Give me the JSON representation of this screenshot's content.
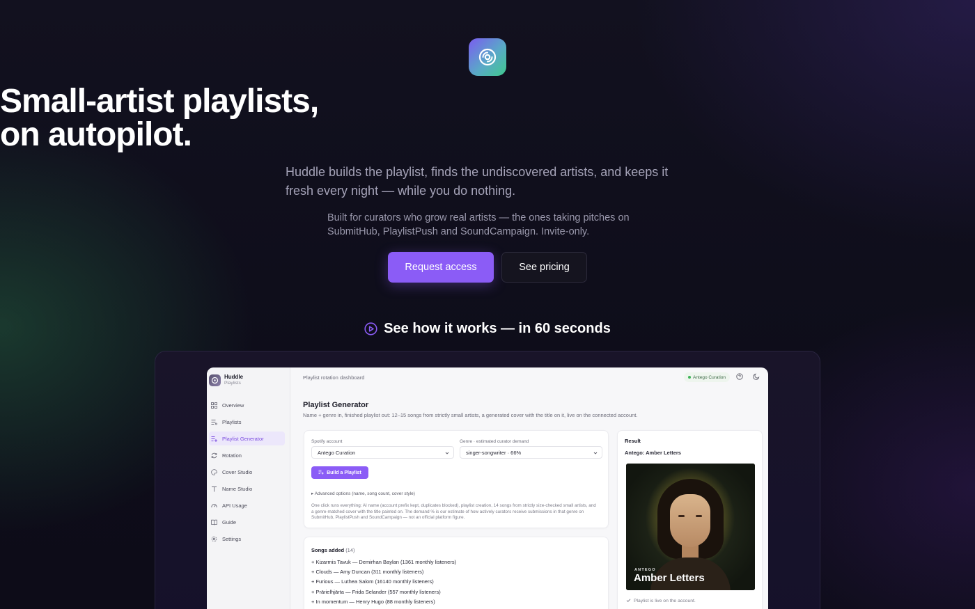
{
  "hero": {
    "headline_line1": "Small-artist playlists,",
    "headline_line2": "on autopilot.",
    "subhead": "Huddle builds the playlist, finds the undiscovered artists, and keeps it fresh every night — while you do nothing.",
    "subhead2": "Built for curators who grow real artists — the ones taking pitches on SubmitHub, PlaylistPush and SoundCampaign. Invite-only.",
    "primary_cta": "Request access",
    "secondary_cta": "See pricing",
    "how_it_works": "See how it works — in 60 seconds"
  },
  "colors": {
    "accent": "#8b5cf6",
    "background": "#0f0e1c",
    "logo_gradient": [
      "#7b5cf0",
      "#3fc98d"
    ]
  },
  "app": {
    "brand": {
      "name": "Huddle",
      "sub": "Playlists"
    },
    "sidebar": [
      {
        "label": "Overview",
        "icon": "grid-icon"
      },
      {
        "label": "Playlists",
        "icon": "list-icon"
      },
      {
        "label": "Playlist Generator",
        "icon": "list-plus-icon",
        "active": true
      },
      {
        "label": "Rotation",
        "icon": "refresh-icon"
      },
      {
        "label": "Cover Studio",
        "icon": "palette-icon"
      },
      {
        "label": "Name Studio",
        "icon": "type-icon"
      },
      {
        "label": "API Usage",
        "icon": "gauge-icon"
      },
      {
        "label": "Guide",
        "icon": "book-icon"
      },
      {
        "label": "Settings",
        "icon": "gear-icon"
      }
    ],
    "topbar": {
      "title": "Playlist rotation dashboard",
      "account_badge": "Antego Curation"
    },
    "generator": {
      "title": "Playlist Generator",
      "description": "Name + genre in, finished playlist out: 12–15 songs from strictly small artists, a generated cover with the title on it, live on the connected account.",
      "account_label": "Spotify account",
      "account_value": "Antego Curation",
      "genre_label": "Genre · estimated curator demand",
      "genre_value": "singer-songwriter · 66%",
      "build_button": "Build a Playlist",
      "advanced": "▸ Advanced options (name, song count, cover style)",
      "note": "One click runs everything: AI name (account prefix kept, duplicates blocked), playlist creation, 14 songs from strictly size-checked small artists, and a genre-matched cover with the title painted on. The demand % is our estimate of how actively curators receive submissions in that genre on SubmitHub, PlaylistPush and SoundCampaign — not an official platform figure."
    },
    "result": {
      "label": "Result",
      "title": "Antego: Amber Letters",
      "cover_small": "ANTEGO",
      "cover_big": "Amber Letters",
      "live_note": "Playlist is live on the account."
    },
    "songs": {
      "title": "Songs added",
      "count": "(14)",
      "items": [
        "+ Kizarmis Tavuk — Demirhan Baylan (1361 monthly listeners)",
        "+ Clouds — Amy Duncan (311 monthly listeners)",
        "+ Furious — Luthea Salom (16140 monthly listeners)",
        "+ Prärielhjärta — Frida Selander (557 monthly listeners)",
        "+ In momentum — Henry Hugo (88 monthly listeners)"
      ]
    }
  }
}
